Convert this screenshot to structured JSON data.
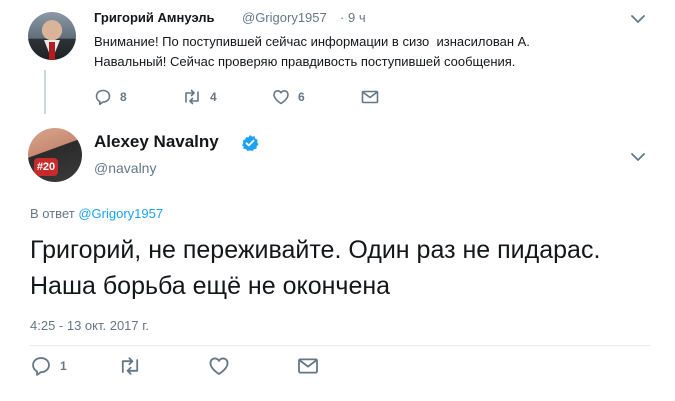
{
  "first_tweet": {
    "author_name": "Григорий Амнуэль",
    "author_handle": "@Grigory1957",
    "separator": "·",
    "time": "9 ч",
    "text": "Внимание! По поступившей сейчас информации в сизо  изнасилован А.\nНавальный! Сейчас проверяю правдивость поступившей сообщения.",
    "replies": "8",
    "retweets": "4",
    "likes": "6"
  },
  "main_tweet": {
    "author_name": "Alexey Navalny",
    "author_handle": "@navalny",
    "avatar_badge": "#20",
    "reply_prefix": "В ответ",
    "reply_to": "@Grigory1957",
    "text": "Григорий, не переживайте. Один раз не пидарас. Наша борьба ещё не окончена",
    "date": "4:25 - 13 окт. 2017 г.",
    "replies": "1"
  },
  "colors": {
    "text": "#14171a",
    "muted": "#657786",
    "link": "#1da1f2",
    "verified": "#1da1f2",
    "thread_line": "#ccd6dd"
  },
  "icons": [
    "reply-icon",
    "retweet-icon",
    "like-icon",
    "message-icon",
    "chevron-down-icon",
    "verified-badge-icon"
  ]
}
